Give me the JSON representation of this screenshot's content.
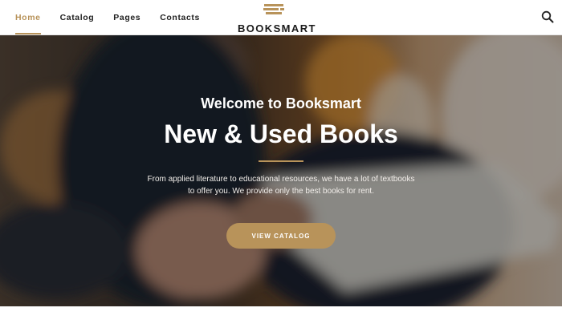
{
  "nav": {
    "items": [
      {
        "label": "Home"
      },
      {
        "label": "Catalog"
      },
      {
        "label": "Pages"
      },
      {
        "label": "Contacts"
      }
    ]
  },
  "brand": {
    "name": "BOOKSMART",
    "accent": "#b8935a"
  },
  "hero": {
    "welcome": "Welcome to Booksmart",
    "headline": "New & Used Books",
    "description_line1": "From applied literature to educational resources, we have a lot of textbooks",
    "description_line2": "to offer you. We provide only the best books for rent.",
    "cta_label": "VIEW CATALOG"
  },
  "icons": {
    "search": "search-icon",
    "logo": "books-stack-icon"
  }
}
